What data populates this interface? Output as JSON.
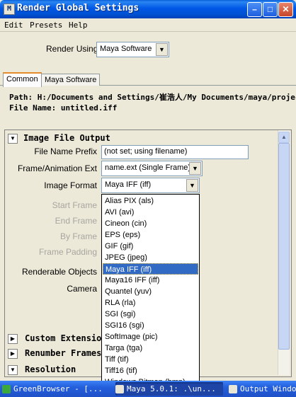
{
  "window": {
    "title": "Render Global Settings",
    "icon_glyph": "M",
    "controls": [
      "minimize-icon",
      "maximize-icon",
      "close-icon"
    ]
  },
  "menubar": {
    "items": [
      "Edit",
      "Presets",
      "Help"
    ]
  },
  "render_using": {
    "label": "Render Using",
    "value": "Maya Software"
  },
  "tabs": [
    {
      "label": "Common",
      "active": true
    },
    {
      "label": "Maya Software",
      "active": false
    }
  ],
  "path": {
    "line": "Path: H:/Documents and Settings/崔浩人/My Documents/maya/projec",
    "file_name": "File Name:  untitled.iff"
  },
  "sections": {
    "image_file_output": "Image File Output",
    "custom_extension": "Custom Extension",
    "renumber_frames": "Renumber Frames",
    "resolution": "Resolution"
  },
  "fields": {
    "file_name_prefix": {
      "label": "File Name Prefix",
      "value": "(not set; using filename)"
    },
    "frame_animation_ext": {
      "label": "Frame/Animation Ext",
      "value": "name.ext (Single Frame)"
    },
    "image_format": {
      "label": "Image Format",
      "value": "Maya IFF (iff)"
    },
    "start_frame": "Start Frame",
    "end_frame": "End Frame",
    "by_frame": "By Frame",
    "frame_padding": "Frame Padding",
    "renderable_objects": "Renderable Objects",
    "camera": "Camera"
  },
  "image_format_options": [
    "Alias PIX (als)",
    "AVI (avi)",
    "Cineon (cin)",
    "EPS (eps)",
    "GIF (gif)",
    "JPEG (jpeg)",
    "Maya IFF (iff)",
    "Maya16 IFF (iff)",
    "Quantel (yuv)",
    "RLA (rla)",
    "SGI (sgi)",
    "SGI16 (sgi)",
    "SoftImage (pic)",
    "Targa (tga)",
    "Tiff (tif)",
    "Tiff16 (tif)",
    "Windows Bitmap (bmp)"
  ],
  "selected_option": "Maya IFF (iff)",
  "taskbar": {
    "items": [
      {
        "label": "GreenBrowser - [...",
        "icon": "greenbrowser-icon"
      },
      {
        "label": "Maya 5.0.1: .\\un...",
        "icon": "maya-icon"
      },
      {
        "label": "Output Windo",
        "icon": "maya-icon"
      }
    ]
  },
  "colors": {
    "titlebar": "#0058e6",
    "selection": "#316ac5",
    "active_tab_accent": "#e68b2c"
  }
}
